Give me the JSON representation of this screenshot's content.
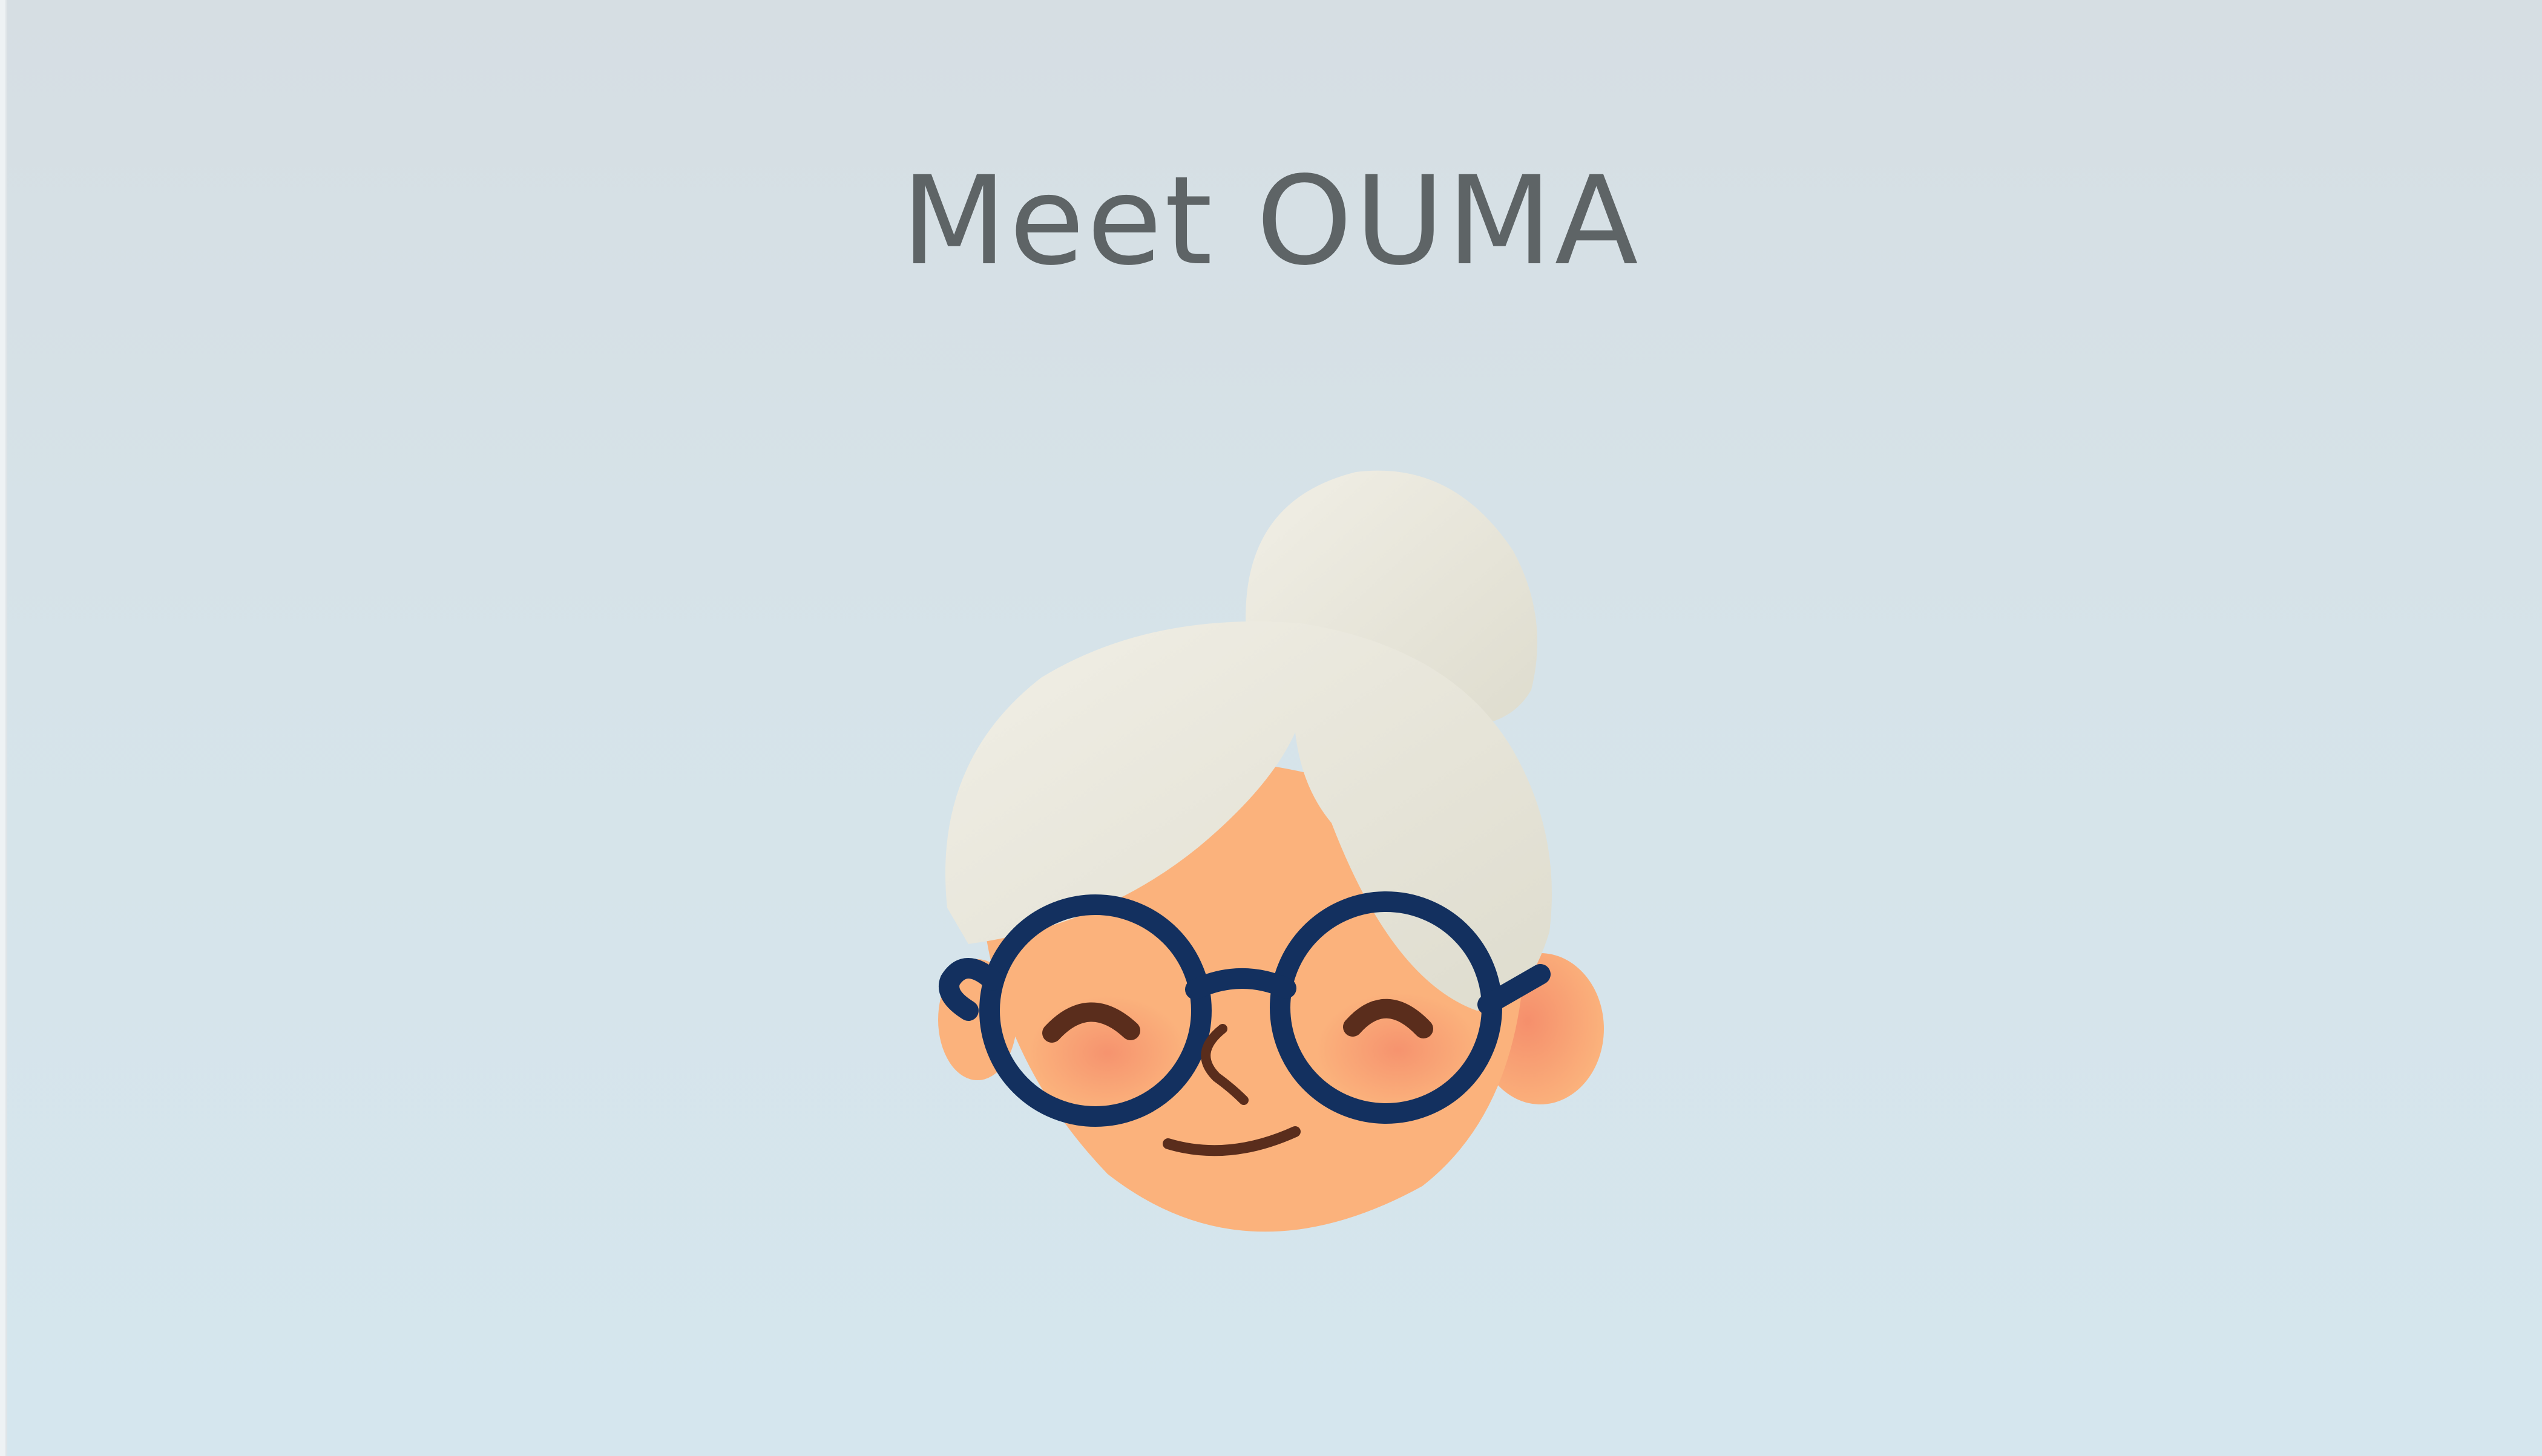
{
  "page": {
    "title": "Meet OUMA"
  },
  "avatar": {
    "icon": "grandmother-avatar-icon",
    "colors": {
      "hair": "#ecebe0",
      "hair_shadow": "#dcdcd0",
      "skin": "#fbb27c",
      "blush": "#f7906a",
      "glasses": "#13305f",
      "features": "#5a2d1c"
    }
  },
  "colors": {
    "background_top": "#d6dee3",
    "background_bottom": "#d5e6ee",
    "title_text": "#5e6466"
  }
}
